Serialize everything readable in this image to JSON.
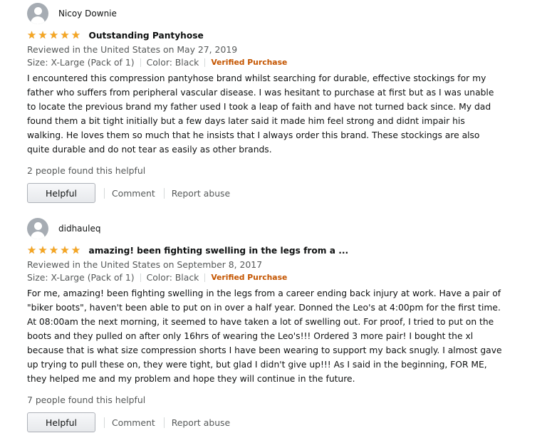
{
  "reviews": [
    {
      "name": "Nicoy Downie",
      "rating": 5,
      "title": "Outstanding Pantyhose",
      "date": "Reviewed in the United States on May 27, 2019",
      "size": "Size: X-Large (Pack of 1)",
      "color": "Color: Black",
      "verified": "Verified Purchase",
      "lines": [
        "I encountered this compression pantyhose brand whilst searching for durable, effective stockings for my",
        "father who suffers from peripheral vascular disease. I was hesitant to purchase at first but as I was unable",
        "to locate the previous brand my father used I took a leap of faith and have not turned back since. My dad",
        "found them a bit tight initially but a few days later said it made him feel strong and didnt impair his",
        "walking. He loves them so much that he insists that I always order this brand. These stockings are also",
        "quite durable and do not tear as easily as other brands."
      ],
      "helpful_count": "2 people found this helpful",
      "helpful_label": "Helpful",
      "comment_label": "Comment",
      "report_label": "Report abuse"
    },
    {
      "name": "didhauleq",
      "rating": 5,
      "title": "amazing! been fighting swelling in the legs from a ...",
      "date": "Reviewed in the United States on September 8, 2017",
      "size": "Size: X-Large (Pack of 1)",
      "color": "Color: Black",
      "verified": "Verified Purchase",
      "lines": [
        "For me, amazing! been fighting swelling in the legs from a career ending back injury at work. Have a pair of",
        "\"biker boots\", haven't been able to put on in over a half year. Donned the Leo's at 4:00pm for the first time.",
        "At 08:00am the next morning, it seemed to have taken a lot of swelling out. For proof, I tried to put on the",
        "boots and they pulled on after only 16hrs of wearing the Leo's!!! Ordered 3 more pair! I bought the xl",
        "because that is what size compression shorts I have been wearing to support my back snugly. I almost gave",
        "up trying to pull these on, they were tight, but glad I didn't give up!!! As I said in the beginning, FOR ME,",
        "they helped me and my problem and hope they will continue in the future."
      ],
      "helpful_count": "7 people found this helpful",
      "helpful_label": "Helpful",
      "comment_label": "Comment",
      "report_label": "Report abuse"
    }
  ],
  "colors": {
    "star": "#f5a623",
    "verified": "#c45500",
    "secondary_text": "#565959",
    "avatar": "#a6acb3"
  },
  "icons": {
    "avatar": "default-profile-icon",
    "star": "star-filled-icon"
  }
}
